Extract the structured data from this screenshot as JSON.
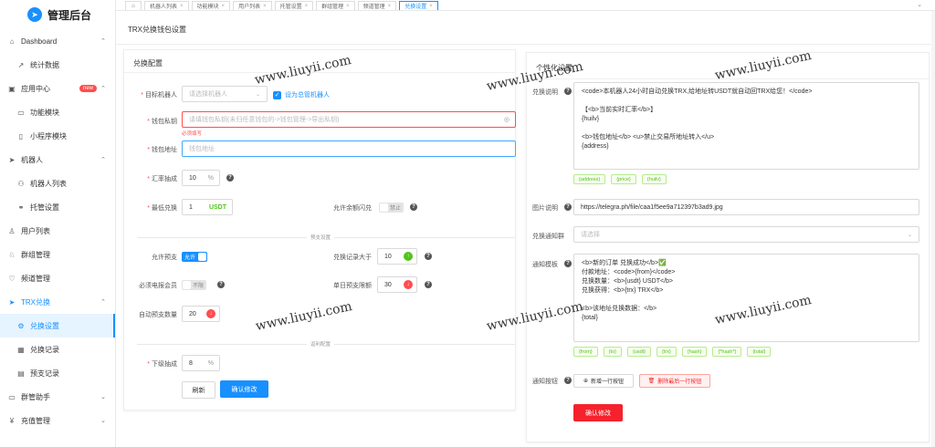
{
  "app": {
    "logo_glyph": "➤",
    "title": "管理后台",
    "accent": "#1890ff"
  },
  "sidebar": {
    "items": [
      {
        "label": "Dashboard",
        "icon": "home-icon",
        "glyph": "⌂",
        "level": 0,
        "arrow": "⌃"
      },
      {
        "label": "统计数据",
        "icon": "trend-icon",
        "glyph": "↗",
        "level": 1
      },
      {
        "label": "应用中心",
        "icon": "app-icon",
        "glyph": "▣",
        "level": 0,
        "badge": "new",
        "arrow": "⌃"
      },
      {
        "label": "功能模块",
        "icon": "module-icon",
        "glyph": "▭",
        "level": 1
      },
      {
        "label": "小程序模块",
        "icon": "miniapp-icon",
        "glyph": "▯",
        "level": 1
      },
      {
        "label": "机器人",
        "icon": "send-icon",
        "glyph": "➤",
        "level": 0,
        "arrow": "⌃"
      },
      {
        "label": "机器人列表",
        "icon": "robot-icon",
        "glyph": "⚇",
        "level": 1
      },
      {
        "label": "托管设置",
        "icon": "link-icon",
        "glyph": "⚭",
        "level": 1
      },
      {
        "label": "用户列表",
        "icon": "user-icon",
        "glyph": "♙",
        "level": 0
      },
      {
        "label": "群组管理",
        "icon": "group-icon",
        "glyph": "♘",
        "level": 0
      },
      {
        "label": "频道管理",
        "icon": "heart-icon",
        "glyph": "♡",
        "level": 0
      },
      {
        "label": "TRX兑换",
        "icon": "exchange-icon",
        "glyph": "➤",
        "level": 0,
        "arrow": "⌃",
        "open": true
      },
      {
        "label": "兑换设置",
        "icon": "settings-icon",
        "glyph": "⚙",
        "level": 1,
        "active": true
      },
      {
        "label": "兑换记录",
        "icon": "table-icon",
        "glyph": "▦",
        "level": 1
      },
      {
        "label": "预支记录",
        "icon": "file-icon",
        "glyph": "▤",
        "level": 1
      },
      {
        "label": "群管助手",
        "icon": "chat-icon",
        "glyph": "▭",
        "level": 0,
        "arrow": "⌄"
      },
      {
        "label": "充值管理",
        "icon": "yen-icon",
        "glyph": "¥",
        "level": 0,
        "arrow": "⌄"
      }
    ]
  },
  "tabs": [
    {
      "label": "",
      "home": true
    },
    {
      "label": "机器人列表"
    },
    {
      "label": "功能模块"
    },
    {
      "label": "用户列表"
    },
    {
      "label": "托管设置"
    },
    {
      "label": "群组管理"
    },
    {
      "label": "频道管理"
    },
    {
      "label": "兑换设置",
      "active": true
    }
  ],
  "tab_close": "×",
  "page_title": "TRX兑换钱包设置",
  "left": {
    "title": "兑换配置",
    "target_robot_label": "目标机器人",
    "target_robot_placeholder": "请选择机器人",
    "default_robot_label": "设为总管机器人",
    "wallet_key_label": "钱包私钥",
    "wallet_key_placeholder": "请填钱包私钥(未归任意钱包的->钱包管理->导出私钥)",
    "wallet_key_error": "必须填写",
    "wallet_address_label": "钱包地址",
    "wallet_address_placeholder": "钱包地址",
    "rate_label": "汇率抽成",
    "rate_value": "10",
    "rate_suffix": "%",
    "min_label": "最低兑换",
    "min_value": "1",
    "min_suffix": "USDT",
    "balance_flash_label": "允许余额闪兑",
    "balance_flash_state": "禁止",
    "prepay_divider": "预支设置",
    "allow_prepay_label": "允许预支",
    "allow_prepay_state": "允许",
    "record_gt_label": "兑换记录大于",
    "record_gt_value": "10",
    "telegram_member_label": "必须电报会员",
    "telegram_member_state": "不限",
    "single_limit_label": "单日预支限额",
    "single_limit_value": "30",
    "auto_prepay_label": "自动预支数量",
    "auto_prepay_value": "20",
    "invite_divider": "返利配置",
    "lower_label": "下级抽成",
    "lower_value": "8",
    "lower_suffix": "%",
    "refresh_btn": "刷新",
    "confirm_btn": "确认修改"
  },
  "right": {
    "title": "个性化设置",
    "desc_label": "兑换说明",
    "desc_lines": [
      "<code>本机器人24小时自动兑换TRX,给地址转USDT就自动回TRX给您！</code>",
      "",
      "【<b>当前实时汇率</b>】",
      "{huilv}",
      "",
      "<b>钱包地址</b> <u>禁止交易所地址转入</u>",
      "{address}"
    ],
    "desc_tags": [
      "{address}",
      "{price}",
      "{huilv}"
    ],
    "image_label": "图片说明",
    "image_value": "https://telegra.ph/file/caa1f5ee9a712397b3ad9.jpg",
    "notify_group_label": "兑换通知群",
    "notify_group_placeholder": "请选择",
    "notify_tpl_label": "通知模板",
    "notify_lines": [
      "<b>新的订单 兑换成功</b>✅",
      "付款地址：<code>{from}</code>",
      "兑换数量：<b>{usdt} USDT</b>",
      "兑换获得：<b>{trx} TRX</b>",
      "",
      "<b>该地址兑换数据：</b>",
      "{total}"
    ],
    "notify_tags": [
      "{from}",
      "{to}",
      "{usdt}",
      "{trx}",
      "{hash}",
      "{*hash*}",
      "{total}"
    ],
    "notify_btn_label": "通知按钮",
    "add_row_btn": "新增一行按钮",
    "del_row_btn": "删除最后一行按钮",
    "confirm_btn": "确认修改"
  },
  "icons": {
    "help": "?",
    "check": "✓",
    "caret": "⌄",
    "eye": "◎",
    "plus": "⊕",
    "trash": "🗑",
    "up": "↑",
    "down": "↓"
  },
  "watermark": "www.liuyii.com"
}
